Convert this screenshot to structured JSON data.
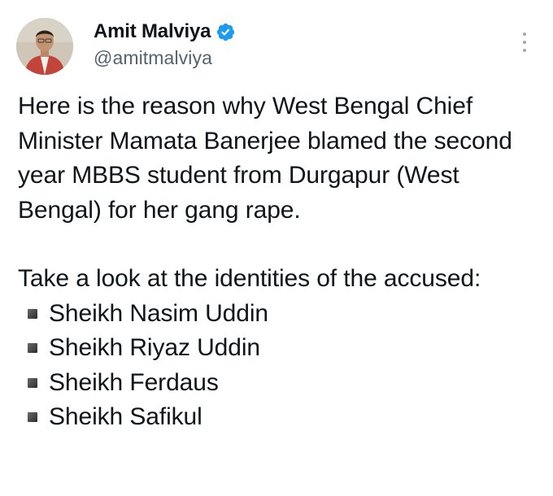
{
  "author": {
    "display_name": "Amit Malviya",
    "handle": "@amitmalviya",
    "verified": true,
    "verified_color": "#1d9bf0"
  },
  "tweet": {
    "paragraph1": "Here is the reason why West Bengal Chief Minister Mamata Banerjee blamed the second year MBBS student from Durgapur (West Bengal) for her gang rape.",
    "paragraph2": "Take a look at the identities of the accused:",
    "accused": [
      "Sheikh Nasim Uddin",
      "Sheikh Riyaz Uddin",
      "Sheikh Ferdaus",
      "Sheikh Safikul"
    ],
    "bullet_icon": "black-small-square-icon"
  },
  "icons": {
    "more": "more-options-icon",
    "verified": "verified-badge-icon"
  }
}
